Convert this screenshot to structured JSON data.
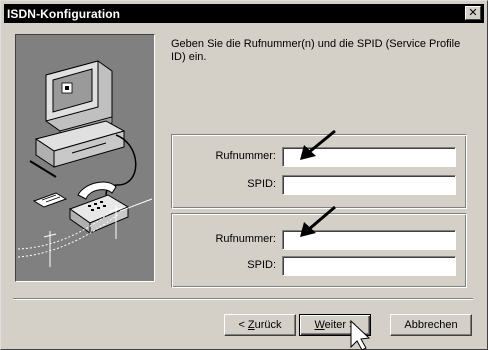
{
  "window": {
    "title": "ISDN-Konfiguration",
    "close_glyph": "✕"
  },
  "instruction": "Geben Sie die Rufnummer(n) und die SPID (Service Profile ID) ein.",
  "groups": [
    {
      "rufnummer_label": "Rufnummer:",
      "spid_label": "SPID:",
      "rufnummer_value": "",
      "spid_value": ""
    },
    {
      "rufnummer_label": "Rufnummer:",
      "spid_label": "SPID:",
      "rufnummer_value": "",
      "spid_value": ""
    }
  ],
  "buttons": {
    "back_prefix": "< ",
    "back_mnemonic": "Z",
    "back_rest": "urück",
    "next_mnemonic": "W",
    "next_rest": "eiter >",
    "cancel": "Abbrechen"
  },
  "colors": {
    "face": "#d4d0c8",
    "titlebar": "#000000",
    "illustration_bg": "#808080"
  },
  "icons": {
    "close": "close-icon",
    "annotation_arrow": "arrow-annotation-icon",
    "cursor": "mouse-pointer-icon"
  }
}
